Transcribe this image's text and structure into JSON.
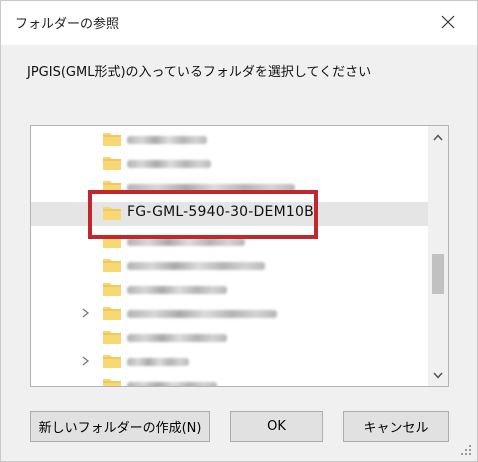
{
  "window": {
    "title": "フォルダーの参照",
    "close_icon": "close-icon"
  },
  "prompt": "JPGIS(GML形式)の入っているフォルダを選択してください",
  "tree": {
    "selected_folder": "FG-GML-5940-30-DEM10B",
    "folder_icon": "folder-icon",
    "expand_icon": "chevron-right-icon",
    "rows_obscured_note": "other folder names are blurred"
  },
  "colors": {
    "highlight": "#c0282e",
    "folder": "#f8d775"
  },
  "buttons": {
    "new_folder": "新しいフォルダーの作成(N)",
    "ok": "OK",
    "cancel": "キャンセル"
  }
}
